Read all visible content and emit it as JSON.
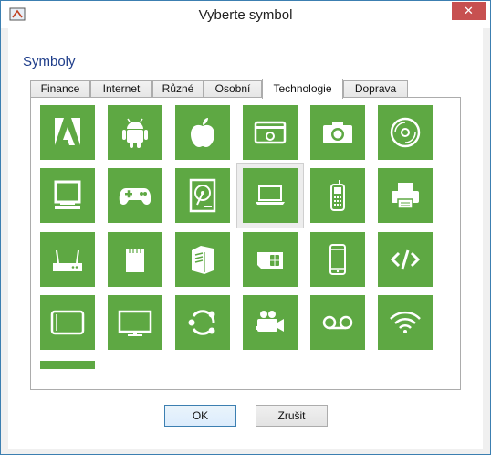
{
  "window": {
    "title": "Vyberte symbol",
    "close_glyph": "✕"
  },
  "group_label": "Symboly",
  "tabs": [
    {
      "label": "Finance",
      "active": false
    },
    {
      "label": "Internet",
      "active": false
    },
    {
      "label": "Různé",
      "active": false
    },
    {
      "label": "Osobní",
      "active": false
    },
    {
      "label": "Technologie",
      "active": true
    },
    {
      "label": "Doprava",
      "active": false
    }
  ],
  "symbols": [
    {
      "icon": "adobe-icon"
    },
    {
      "icon": "android-icon"
    },
    {
      "icon": "apple-icon"
    },
    {
      "icon": "card-reader-icon"
    },
    {
      "icon": "camera-icon"
    },
    {
      "icon": "cd-icon"
    },
    {
      "icon": "monitor-icon"
    },
    {
      "icon": "gamepad-icon"
    },
    {
      "icon": "hard-drive-icon"
    },
    {
      "icon": "laptop-icon",
      "selected": true
    },
    {
      "icon": "mobile-phone-icon"
    },
    {
      "icon": "printer-icon"
    },
    {
      "icon": "router-icon"
    },
    {
      "icon": "sd-card-icon"
    },
    {
      "icon": "server-icon"
    },
    {
      "icon": "sim-card-icon"
    },
    {
      "icon": "smartphone-icon"
    },
    {
      "icon": "code-icon"
    },
    {
      "icon": "tablet-icon"
    },
    {
      "icon": "tv-icon"
    },
    {
      "icon": "ubuntu-icon"
    },
    {
      "icon": "video-camera-icon"
    },
    {
      "icon": "voicemail-icon"
    },
    {
      "icon": "wifi-icon"
    }
  ],
  "colors": {
    "tile": "#5ea843",
    "selection": "#ededed",
    "group_label": "#1e3d8a"
  },
  "buttons": {
    "ok": "OK",
    "cancel": "Zrušit"
  }
}
